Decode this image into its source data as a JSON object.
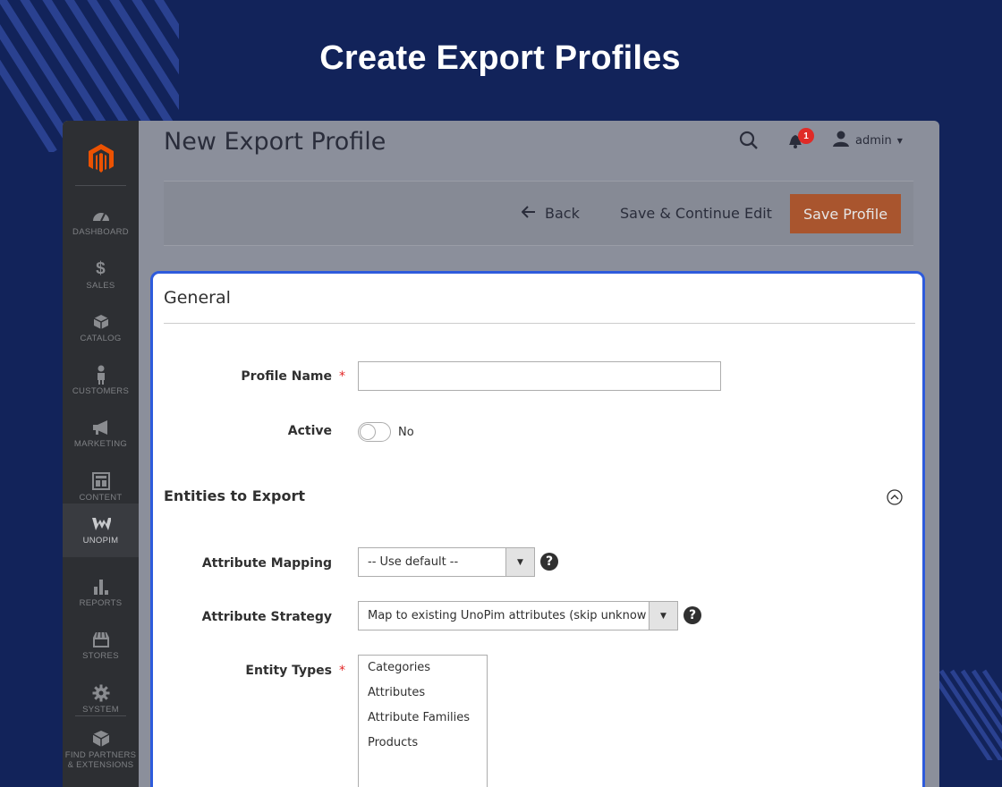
{
  "hero": {
    "title": "Create Export Profiles"
  },
  "sidebar": {
    "items": [
      {
        "label": "Dashboard",
        "icon": "dashboard-icon"
      },
      {
        "label": "Sales",
        "icon": "dollar-icon"
      },
      {
        "label": "Catalog",
        "icon": "cube-icon"
      },
      {
        "label": "Customers",
        "icon": "person-icon"
      },
      {
        "label": "Marketing",
        "icon": "megaphone-icon"
      },
      {
        "label": "Content",
        "icon": "layout-icon"
      },
      {
        "label": "UnoPim",
        "icon": "unopim-logo-icon"
      },
      {
        "label": "Reports",
        "icon": "bar-chart-icon"
      },
      {
        "label": "Stores",
        "icon": "store-icon"
      },
      {
        "label": "System",
        "icon": "gear-icon"
      },
      {
        "label_line1": "Find Partners",
        "label_line2": "& Extensions",
        "icon": "box-icon"
      }
    ],
    "active": "UnoPim"
  },
  "header": {
    "page_title": "New Export Profile",
    "notification_count": "1",
    "user": "admin"
  },
  "actions": {
    "back": "Back",
    "save_continue": "Save & Continue Edit",
    "save_profile": "Save Profile"
  },
  "form": {
    "section_title": "General",
    "profile_name_label": "Profile Name",
    "profile_name_value": "",
    "active_label": "Active",
    "active_value": "No",
    "entities_title": "Entities to Export",
    "attribute_mapping_label": "Attribute Mapping",
    "attribute_mapping_value": "-- Use default --",
    "attribute_strategy_label": "Attribute Strategy",
    "attribute_strategy_value": "Map to existing UnoPim attributes (skip unknown)",
    "entity_types_label": "Entity Types",
    "entity_types_options": [
      "Categories",
      "Attributes",
      "Attribute Families",
      "Products"
    ]
  },
  "colors": {
    "background": "#12235a",
    "accent_button": "#a9552e",
    "highlight_border": "#2e5bdc",
    "required": "#e22626"
  }
}
